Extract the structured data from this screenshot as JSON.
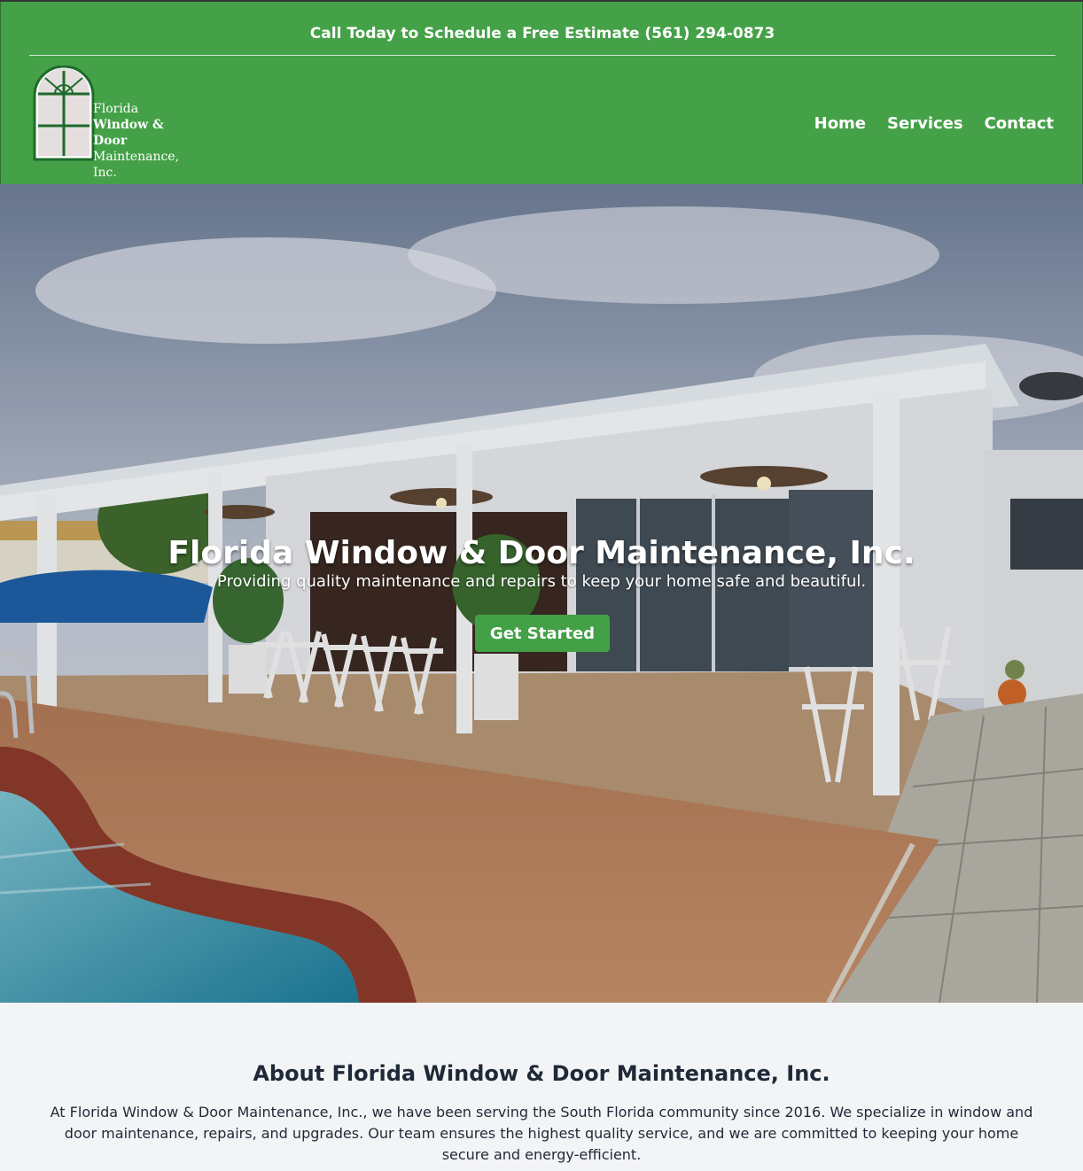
{
  "topbar": {
    "text": "Call Today to Schedule a Free Estimate (561) 294-0873"
  },
  "logo": {
    "line1": "Florida",
    "line2": "Window & Door",
    "line3": "Maintenance, Inc."
  },
  "nav": {
    "items": [
      "Home",
      "Services",
      "Contact"
    ]
  },
  "hero": {
    "title": "Florida Window & Door Maintenance, Inc.",
    "subtitle": "Providing quality maintenance and repairs to keep your home safe and beautiful.",
    "cta_label": "Get Started"
  },
  "about": {
    "heading": "About Florida Window & Door Maintenance, Inc.",
    "body": "At Florida Window & Door Maintenance, Inc., we have been serving the South Florida community since 2016. We specialize in window and door maintenance, repairs, and upgrades. Our team ensures the highest quality service, and we are committed to keeping your home secure and energy-efficient."
  },
  "colors": {
    "brand_green": "#45a148",
    "button_green": "#43a047",
    "text_dark": "#1f2937"
  }
}
